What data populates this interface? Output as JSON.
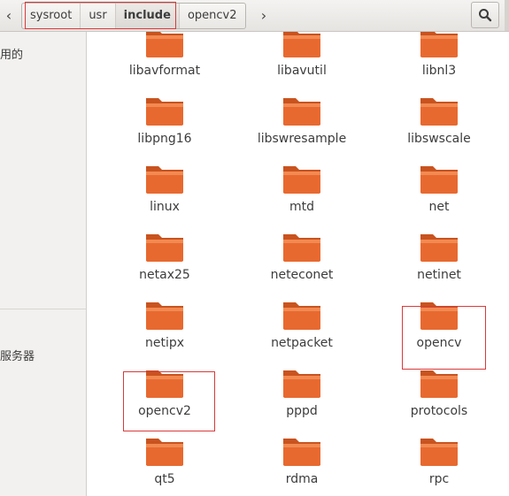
{
  "breadcrumb": [
    "sysroot",
    "usr",
    "include",
    "opencv2"
  ],
  "sidebar": {
    "labels": [
      "用的",
      "服务器"
    ]
  },
  "folders": [
    {
      "name": "libavformat"
    },
    {
      "name": "libavutil"
    },
    {
      "name": "libnl3"
    },
    {
      "name": "libpng16"
    },
    {
      "name": "libswresample"
    },
    {
      "name": "libswscale"
    },
    {
      "name": "linux"
    },
    {
      "name": "mtd"
    },
    {
      "name": "net"
    },
    {
      "name": "netax25"
    },
    {
      "name": "neteconet"
    },
    {
      "name": "netinet"
    },
    {
      "name": "netipx"
    },
    {
      "name": "netpacket"
    },
    {
      "name": "opencv"
    },
    {
      "name": "opencv2"
    },
    {
      "name": "pppd"
    },
    {
      "name": "protocols"
    },
    {
      "name": "qt5"
    },
    {
      "name": "rdma"
    },
    {
      "name": "rpc"
    }
  ],
  "icons": {
    "back": "chevron-left-icon",
    "forward": "chevron-right-icon",
    "search": "search-icon",
    "folder": "folder-icon"
  },
  "colors": {
    "folder_orange": "#e8692f",
    "highlight_red": "#d93a3a"
  }
}
